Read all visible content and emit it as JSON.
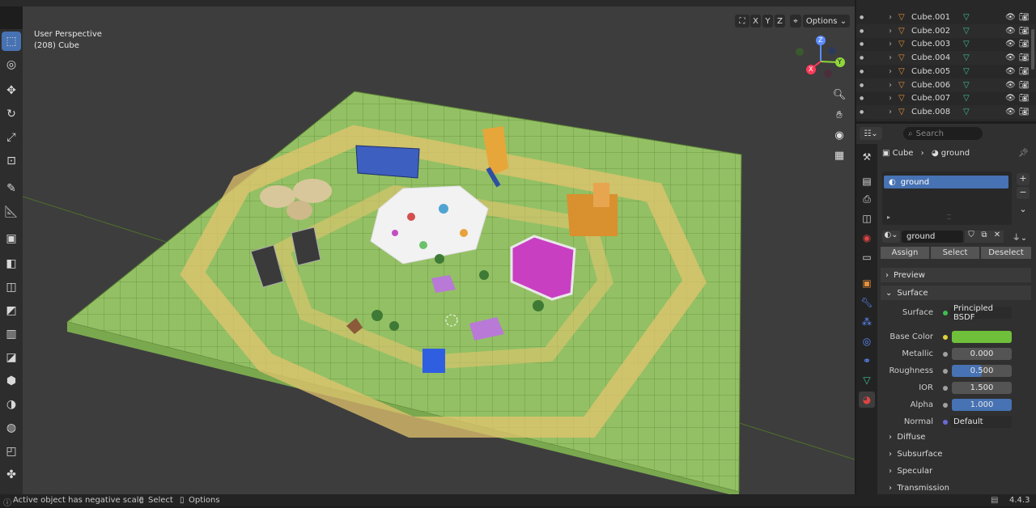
{
  "viewport": {
    "perspective_label": "User Perspective",
    "object_label": "(208) Cube",
    "options_label": "Options",
    "axes": {
      "x": "X",
      "y": "Y",
      "z": "Z"
    },
    "xyz_toggle": [
      "X",
      "Y",
      "Z"
    ]
  },
  "outliner": {
    "items": [
      "Cube.001",
      "Cube.002",
      "Cube.003",
      "Cube.004",
      "Cube.005",
      "Cube.006",
      "Cube.007",
      "Cube.008"
    ]
  },
  "properties": {
    "search_placeholder": "Search",
    "breadcrumb": {
      "object": "Cube",
      "material": "ground"
    },
    "material_slot": "ground",
    "material_name": "ground",
    "buttons": {
      "assign": "Assign",
      "select": "Select",
      "deselect": "Deselect"
    },
    "panels": {
      "preview": "Preview",
      "surface": "Surface"
    },
    "surface": {
      "surface_label": "Surface",
      "surface_value": "Principled BSDF",
      "base_color_label": "Base Color",
      "base_color": "#6fbf3a",
      "metallic_label": "Metallic",
      "metallic": "0.000",
      "roughness_label": "Roughness",
      "roughness": "0.500",
      "roughness_fraction": 0.5,
      "ior_label": "IOR",
      "ior": "1.500",
      "alpha_label": "Alpha",
      "alpha": "1.000",
      "alpha_fraction": 1.0,
      "normal_label": "Normal",
      "normal": "Default"
    },
    "subpanels": [
      "Diffuse",
      "Subsurface",
      "Specular",
      "Transmission"
    ]
  },
  "statusbar": {
    "message": "Active object has negative scale",
    "select": "Select",
    "options": "Options",
    "version": "4.4.3"
  },
  "colors": {
    "accent": "#4772b3",
    "ground_light": "#9bc76a",
    "ground_dark": "#7aa84f",
    "path_yellow": "#d9c06a",
    "object_orange": "#e5903c",
    "mesh_green": "#3fbf9a"
  }
}
